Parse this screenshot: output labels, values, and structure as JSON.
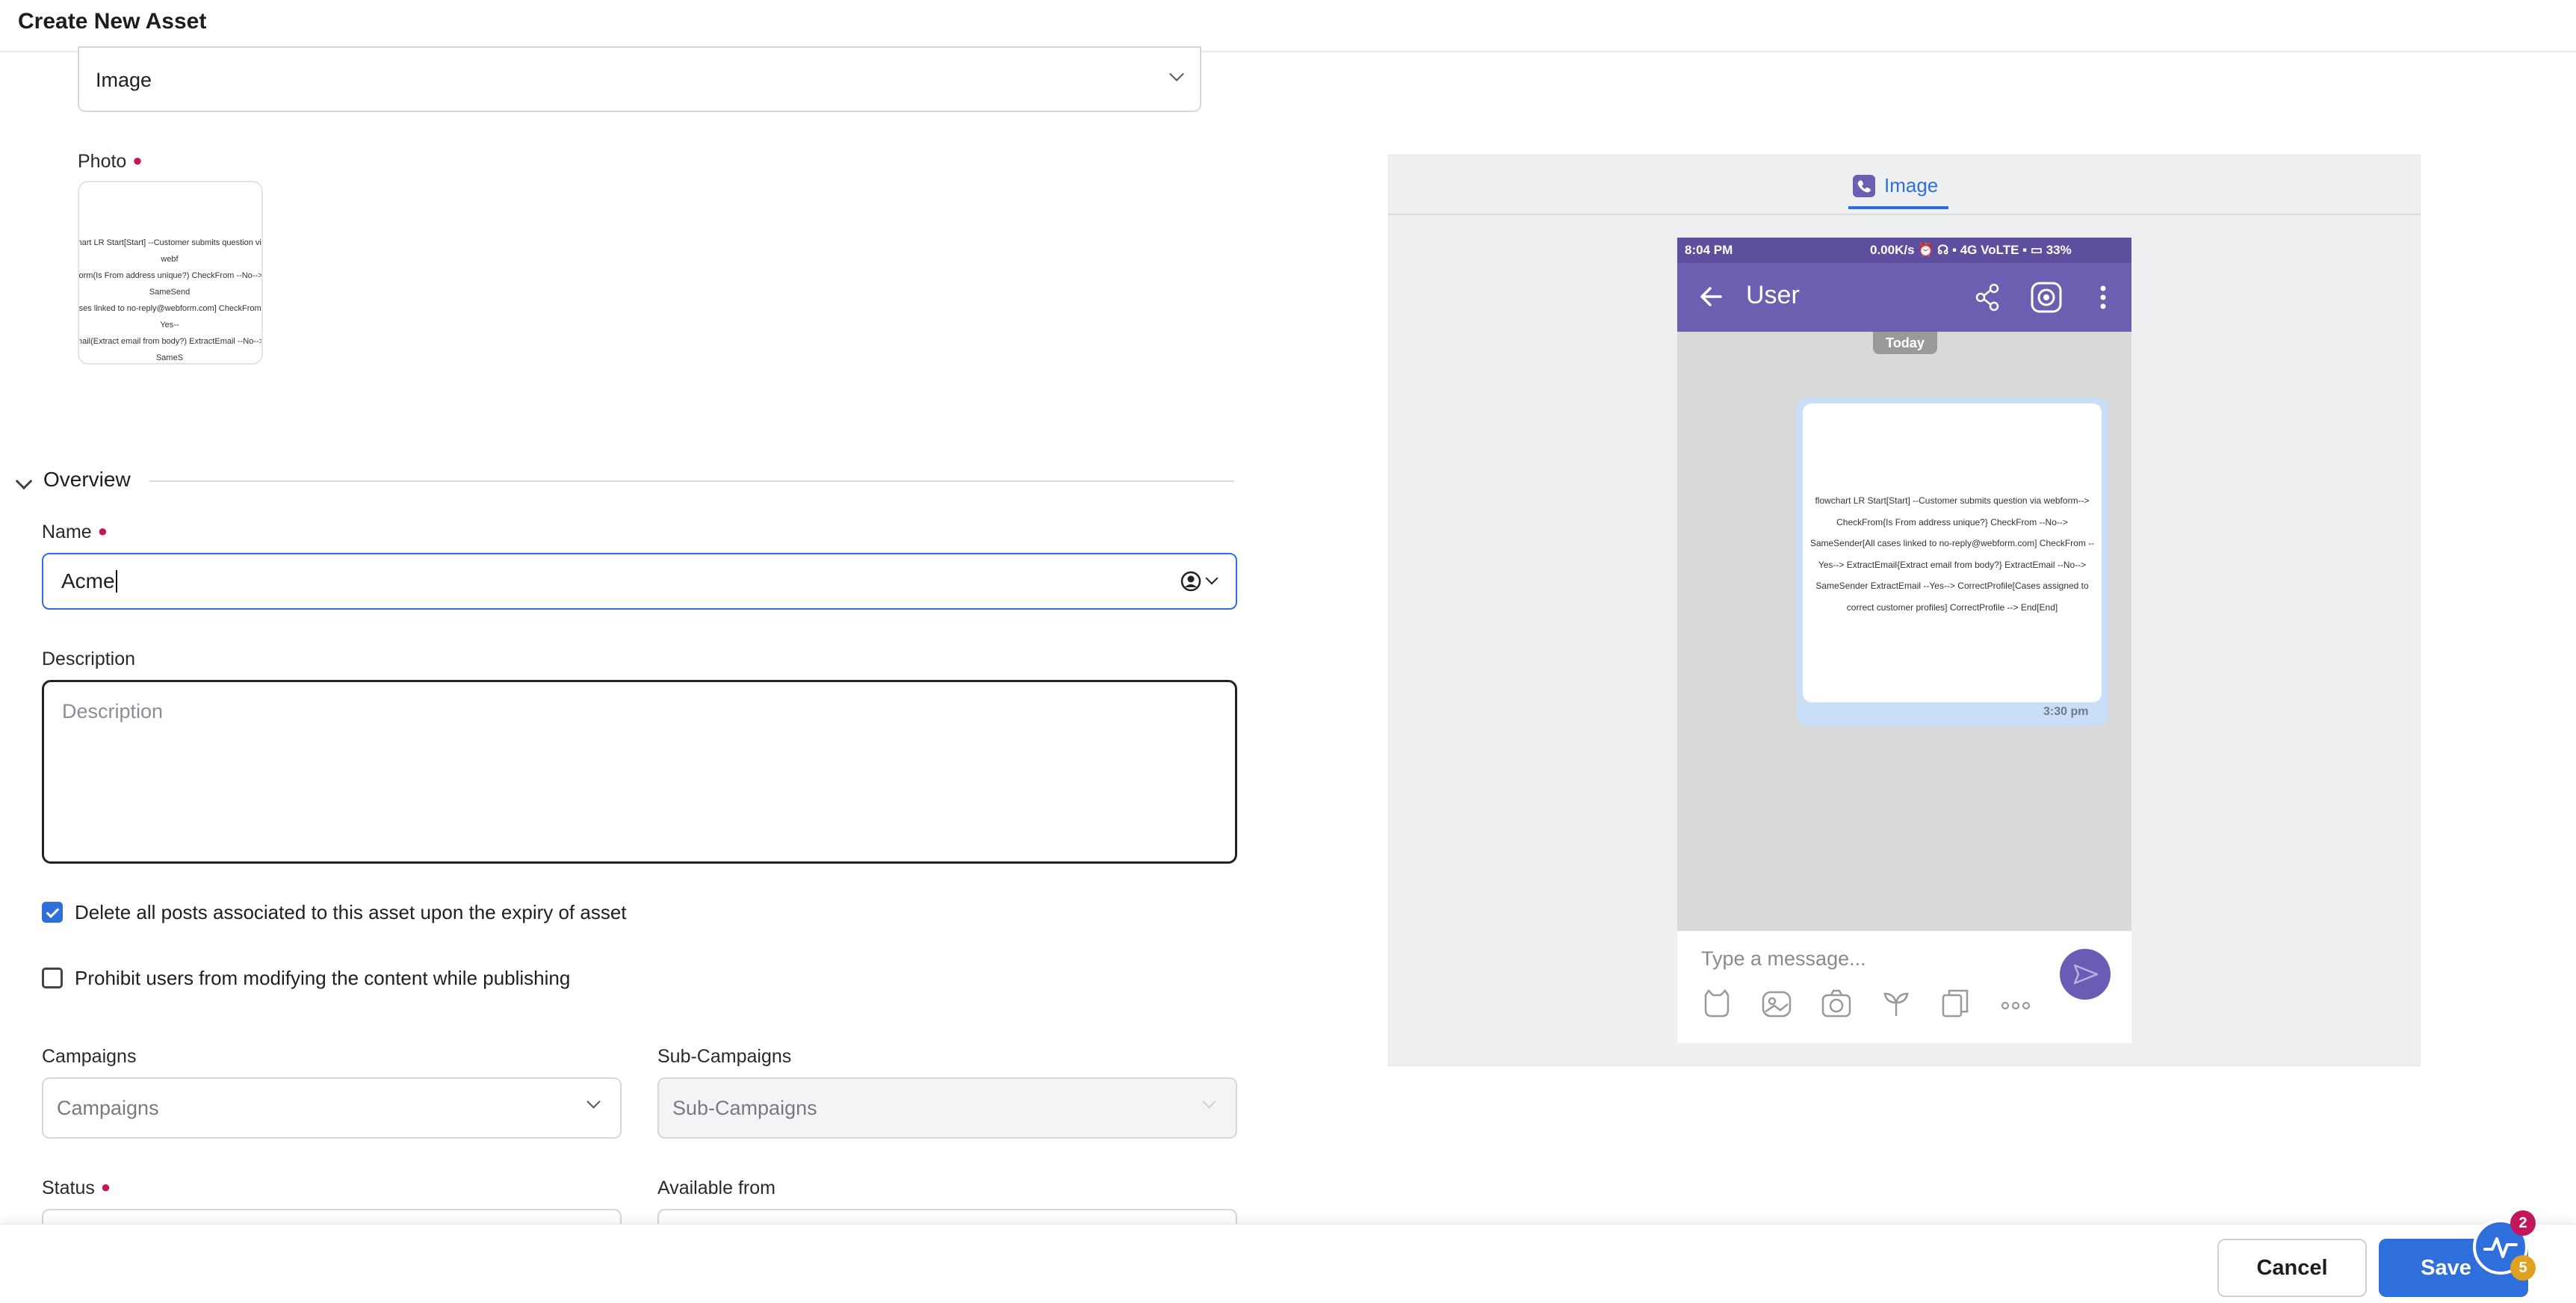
{
  "header": {
    "title": "Create New Asset"
  },
  "asset_type_select": {
    "value": "Image"
  },
  "photo": {
    "label": "Photo",
    "thumbnail_text": "chart LR Start[Start] --Customer submits question via webf\nform(Is From address unique?) CheckFrom --No--> SameSend\ncases linked to no-reply@webform.com] CheckFrom --Yes--\nmail(Extract email from body?) ExtractEmail --No--> SameS\nEmail --Yes--> CorrectProfile[Cases assigned to correct cu\nprofiles] CorrectProfile --> End[End]"
  },
  "overview": {
    "title": "Overview"
  },
  "name_field": {
    "label": "Name",
    "value": "Acme"
  },
  "description_field": {
    "label": "Description",
    "placeholder": "Description"
  },
  "checkboxes": [
    {
      "label": "Delete all posts associated to this asset upon the expiry of asset",
      "checked": true
    },
    {
      "label": "Prohibit users from modifying the content while publishing",
      "checked": false
    }
  ],
  "campaigns": {
    "label": "Campaigns",
    "placeholder": "Campaigns"
  },
  "sub_campaigns": {
    "label": "Sub-Campaigns",
    "placeholder": "Sub-Campaigns"
  },
  "status": {
    "label": "Status"
  },
  "available_from": {
    "label": "Available from"
  },
  "footer": {
    "cancel_label": "Cancel",
    "save_label": "Save",
    "help_badge_top": "2",
    "help_badge_bottom": "5"
  },
  "preview": {
    "tab_label": "Image",
    "phone": {
      "time": "8:04 PM",
      "status_right": "0.00K/s ⏰ ☊ ▪ 4G VoLTE ▪ ▭ 33%",
      "chat_title": "User",
      "date_pill": "Today",
      "message_text": "flowchart LR Start[Start] --Customer submits question via webform--> CheckFrom{Is From address unique?} CheckFrom --No--> SameSender[All cases linked to no-reply@webform.com] CheckFrom --Yes--> ExtractEmail{Extract email from body?} ExtractEmail --No--> SameSender ExtractEmail --Yes--> CorrectProfile[Cases assigned to correct customer profiles] CorrectProfile --> End[End]",
      "message_time": "3:30 pm",
      "composer_placeholder": "Type a message..."
    }
  },
  "colors": {
    "accent": "#2f6fdc",
    "viber_purple": "#6c5eb1",
    "required": "#c2185b"
  }
}
